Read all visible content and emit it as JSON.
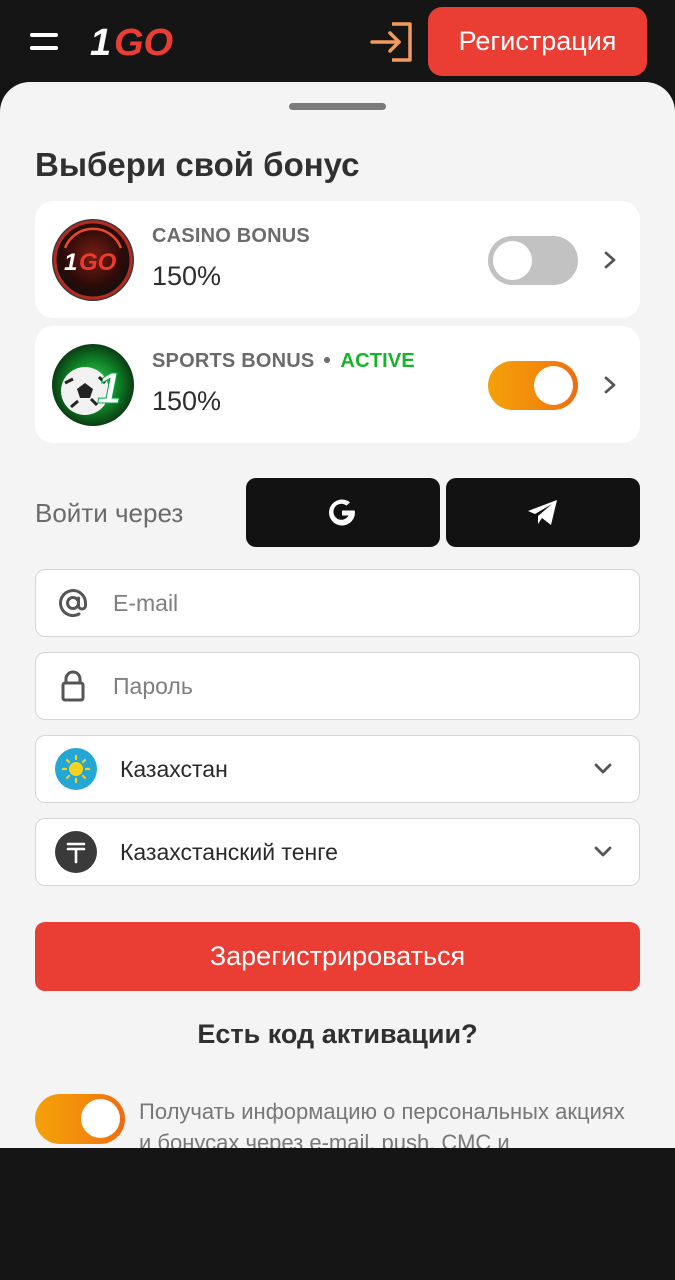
{
  "header": {
    "logo_text": "1GO",
    "register_button": "Регистрация"
  },
  "sheet": {
    "title": "Выбери свой бонус",
    "bonuses": [
      {
        "name": "CASINO BONUS",
        "value": "150%",
        "status": "",
        "enabled": false
      },
      {
        "name": "SPORTS BONUS",
        "value": "150%",
        "status": "ACTIVE",
        "enabled": true
      }
    ],
    "login_via_label": "Войти через",
    "form": {
      "email_placeholder": "E-mail",
      "password_placeholder": "Пароль",
      "country_value": "Казахстан",
      "currency_value": "Казахстанский тенге"
    },
    "submit_button": "Зарегистрироваться",
    "promo_code_link": "Есть код активации?",
    "consent_text": "Получать информацию о персональных акциях и бонусах через e-mail, push, СМС и",
    "consent_enabled": true
  },
  "colors": {
    "accent_red": "#ea3e34",
    "toggle_on": "#f28a0b",
    "active_green": "#19b32a",
    "dark_bg": "#151515"
  },
  "icons": {
    "menu": "hamburger-icon",
    "login": "login-arrow-icon",
    "google": "google-icon",
    "telegram": "telegram-icon",
    "email": "at-sign-icon",
    "password": "lock-icon",
    "country": "kazakhstan-flag-icon",
    "currency": "tenge-icon"
  }
}
